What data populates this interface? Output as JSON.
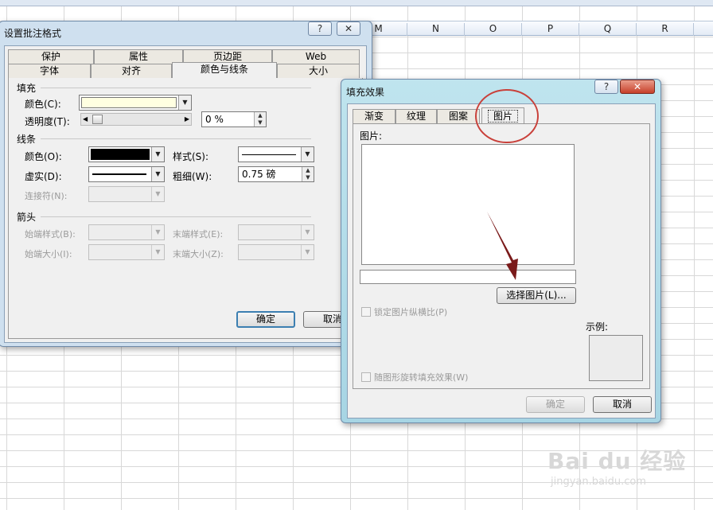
{
  "sheet": {
    "columns": [
      "M",
      "N",
      "O",
      "P",
      "Q",
      "R"
    ]
  },
  "format_dialog": {
    "title": "设置批注格式",
    "help": "?",
    "close": "✕",
    "tabs_row1": [
      "保护",
      "属性",
      "页边距",
      "Web"
    ],
    "tabs_row2": [
      "字体",
      "对齐",
      "颜色与线条",
      "大小"
    ],
    "selected_tab": "颜色与线条",
    "fill": {
      "section": "填充",
      "color_label": "颜色(C):",
      "color_value": "#ffffe1",
      "transparency_label": "透明度(T):",
      "transparency_value": "0 %",
      "slider_fraction": 0
    },
    "line": {
      "section": "线条",
      "color_label": "颜色(O):",
      "dash_label": "虚实(D):",
      "connector_label": "连接符(N):",
      "style_label": "样式(S):",
      "weight_label": "粗细(W):",
      "weight_value": "0.75 磅"
    },
    "arrows": {
      "section": "箭头",
      "begin_style": "始端样式(B):",
      "end_style": "末端样式(E):",
      "begin_size": "始端大小(I):",
      "end_size": "末端大小(Z):"
    },
    "ok": "确定",
    "cancel": "取消"
  },
  "fill_effects": {
    "title": "填充效果",
    "help": "?",
    "close": "✕",
    "tabs": [
      "渐变",
      "纹理",
      "图案",
      "图片"
    ],
    "selected_tab": "图片",
    "picture_label": "图片:",
    "select_button": "选择图片(L)...",
    "lock_aspect": "锁定图片纵横比(P)",
    "rotate": "随图形旋转填充效果(W)",
    "sample_label": "示例:",
    "ok": "确定",
    "cancel": "取消"
  },
  "watermark": {
    "brand": "Bai du 经验",
    "url": "jingyan.baidu.com"
  }
}
